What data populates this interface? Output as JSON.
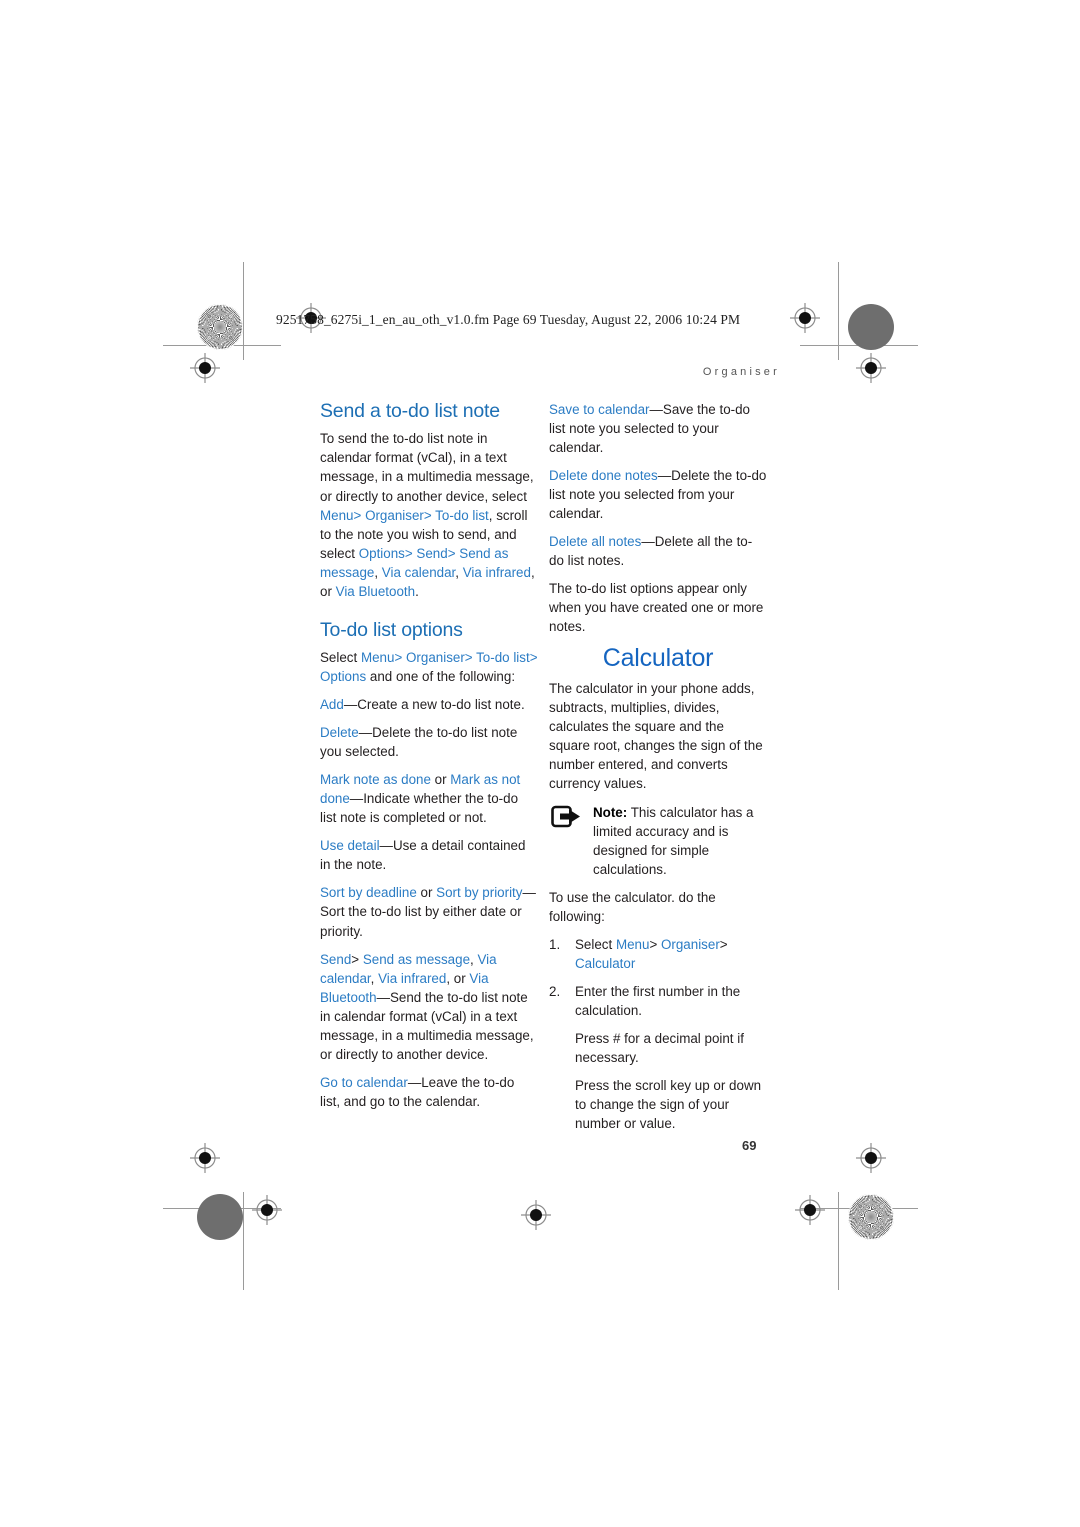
{
  "page": {
    "filename_line": "9251758_6275i_1_en_au_oth_v1.0.fm  Page 69  Tuesday, August 22, 2006  10:24 PM",
    "running_head": "Organiser",
    "folio": "69",
    "accent_heading": "#1d6fb4",
    "accent_title": "#1565c0",
    "accent_inline": "#2b7cc4",
    "body_color": "#231f20"
  },
  "left_column": {
    "section1": {
      "heading": "Send a to-do list note",
      "body_1": "To send the to-do list note in calendar format (vCal), in a text message, in a multimedia message, or directly to another device, select ",
      "ui_menu": "Menu",
      "sep1": ">",
      "ui_organiser": "Organiser",
      "sep2": ">",
      "ui_todolist": "To-do list",
      "body_2": ", scroll to the note you wish to send, and select ",
      "ui_options": "Options",
      "sep3": ">",
      "ui_send": "Send",
      "sep4": ">",
      "ui_send_as_message": "Send as message",
      "body_3": ", ",
      "ui_via_calendar": "Via calendar",
      "body_4": ", ",
      "ui_via_infrared": "Via infrared",
      "body_5": ", or ",
      "ui_via_bluetooth": "Via Bluetooth",
      "body_6": "."
    },
    "section2": {
      "heading": "To-do list options",
      "intro_pre": "Select ",
      "ui_menu": "Menu",
      "sep1": ">",
      "ui_organiser": "Organiser",
      "sep2": ">",
      "ui_todolist": "To-do list",
      "sep3": ">",
      "ui_options": "Options",
      "intro_post": " and one of the following:",
      "items": [
        {
          "terms": [
            "Add"
          ],
          "separators": [],
          "desc": "—Create a new to-do list note."
        },
        {
          "terms": [
            "Delete"
          ],
          "separators": [],
          "desc": "—Delete the to-do list note you selected."
        },
        {
          "terms": [
            "Mark note as done",
            "Mark as not done"
          ],
          "separators": [
            " or "
          ],
          "desc": "—Indicate whether the to-do list note is completed or not."
        },
        {
          "terms": [
            "Use detail"
          ],
          "separators": [],
          "desc": "—Use a detail contained in the note."
        },
        {
          "terms": [
            "Sort by deadline",
            "Sort by priority"
          ],
          "separators": [
            " or "
          ],
          "desc": "—Sort the to-do list by either date or priority."
        },
        {
          "terms": [
            "Send",
            "Send as message",
            "Via calendar",
            "Via infrared",
            "Via Bluetooth"
          ],
          "separators": [
            "> ",
            ", ",
            ", ",
            ", or "
          ],
          "desc": "—Send the to-do list note in calendar format (vCal) in a text message, in a multimedia message, or directly to another device."
        },
        {
          "terms": [
            "Go to calendar"
          ],
          "separators": [],
          "desc": "—Leave the to-do list, and go to the calendar."
        }
      ]
    }
  },
  "right_column": {
    "continued_items": [
      {
        "term": "Save to calendar",
        "desc": "—Save the to-do list note you selected to your calendar."
      },
      {
        "term": "Delete done notes",
        "desc": "—Delete the to-do list note you selected from your calendar."
      },
      {
        "term": "Delete all notes",
        "desc": "—Delete all the to-do list notes."
      }
    ],
    "closing_note": "The to-do list options appear only when you have created one or more notes.",
    "calculator": {
      "title": "Calculator",
      "intro": "The calculator in your phone adds, subtracts, multiplies, divides, calculates the square and the square root, changes the sign of the number entered, and converts currency values.",
      "note_icon": "note-export-icon",
      "note_label": "Note:",
      "note_text": " This calculator has a limited accuracy and is designed for simple calculations.",
      "steps_intro": "To use the calculator. do the following:",
      "steps": [
        {
          "num": "1.",
          "pre": "Select ",
          "terms": [
            "Menu",
            "Organiser",
            "Calculator"
          ],
          "separators": [
            "> ",
            "> "
          ],
          "post": "",
          "extra": []
        },
        {
          "num": "2.",
          "pre": "Enter the first number in the calculation.",
          "terms": [],
          "separators": [],
          "post": "",
          "extra": [
            "Press # for a decimal point if necessary.",
            "Press the scroll key up or down to change the sign of your number or value."
          ]
        }
      ]
    }
  }
}
